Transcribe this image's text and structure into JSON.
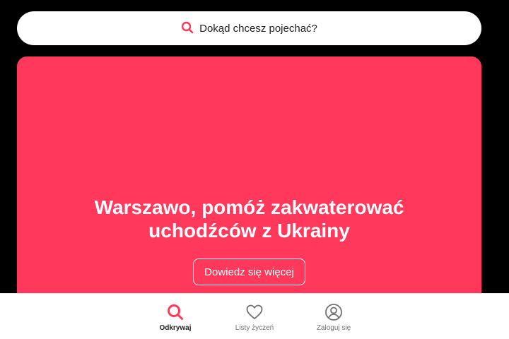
{
  "search": {
    "icon": "search-icon",
    "label": "Dokąd chcesz pojechać?"
  },
  "hero": {
    "title": "Warszawo, pomóż zakwaterować uchodźców z Ukrainy",
    "button_label": "Dowiedz się więcej"
  },
  "bottom_nav": {
    "items": [
      {
        "label": "Odkrywaj",
        "icon": "search-icon",
        "active": true
      },
      {
        "label": "Listy życzeń",
        "icon": "heart-icon",
        "active": false
      },
      {
        "label": "Zaloguj się",
        "icon": "user-icon",
        "active": false
      }
    ]
  },
  "colors": {
    "brand": "#ff385c",
    "background": "#000000",
    "text_primary": "#222222",
    "text_secondary": "#717171"
  }
}
